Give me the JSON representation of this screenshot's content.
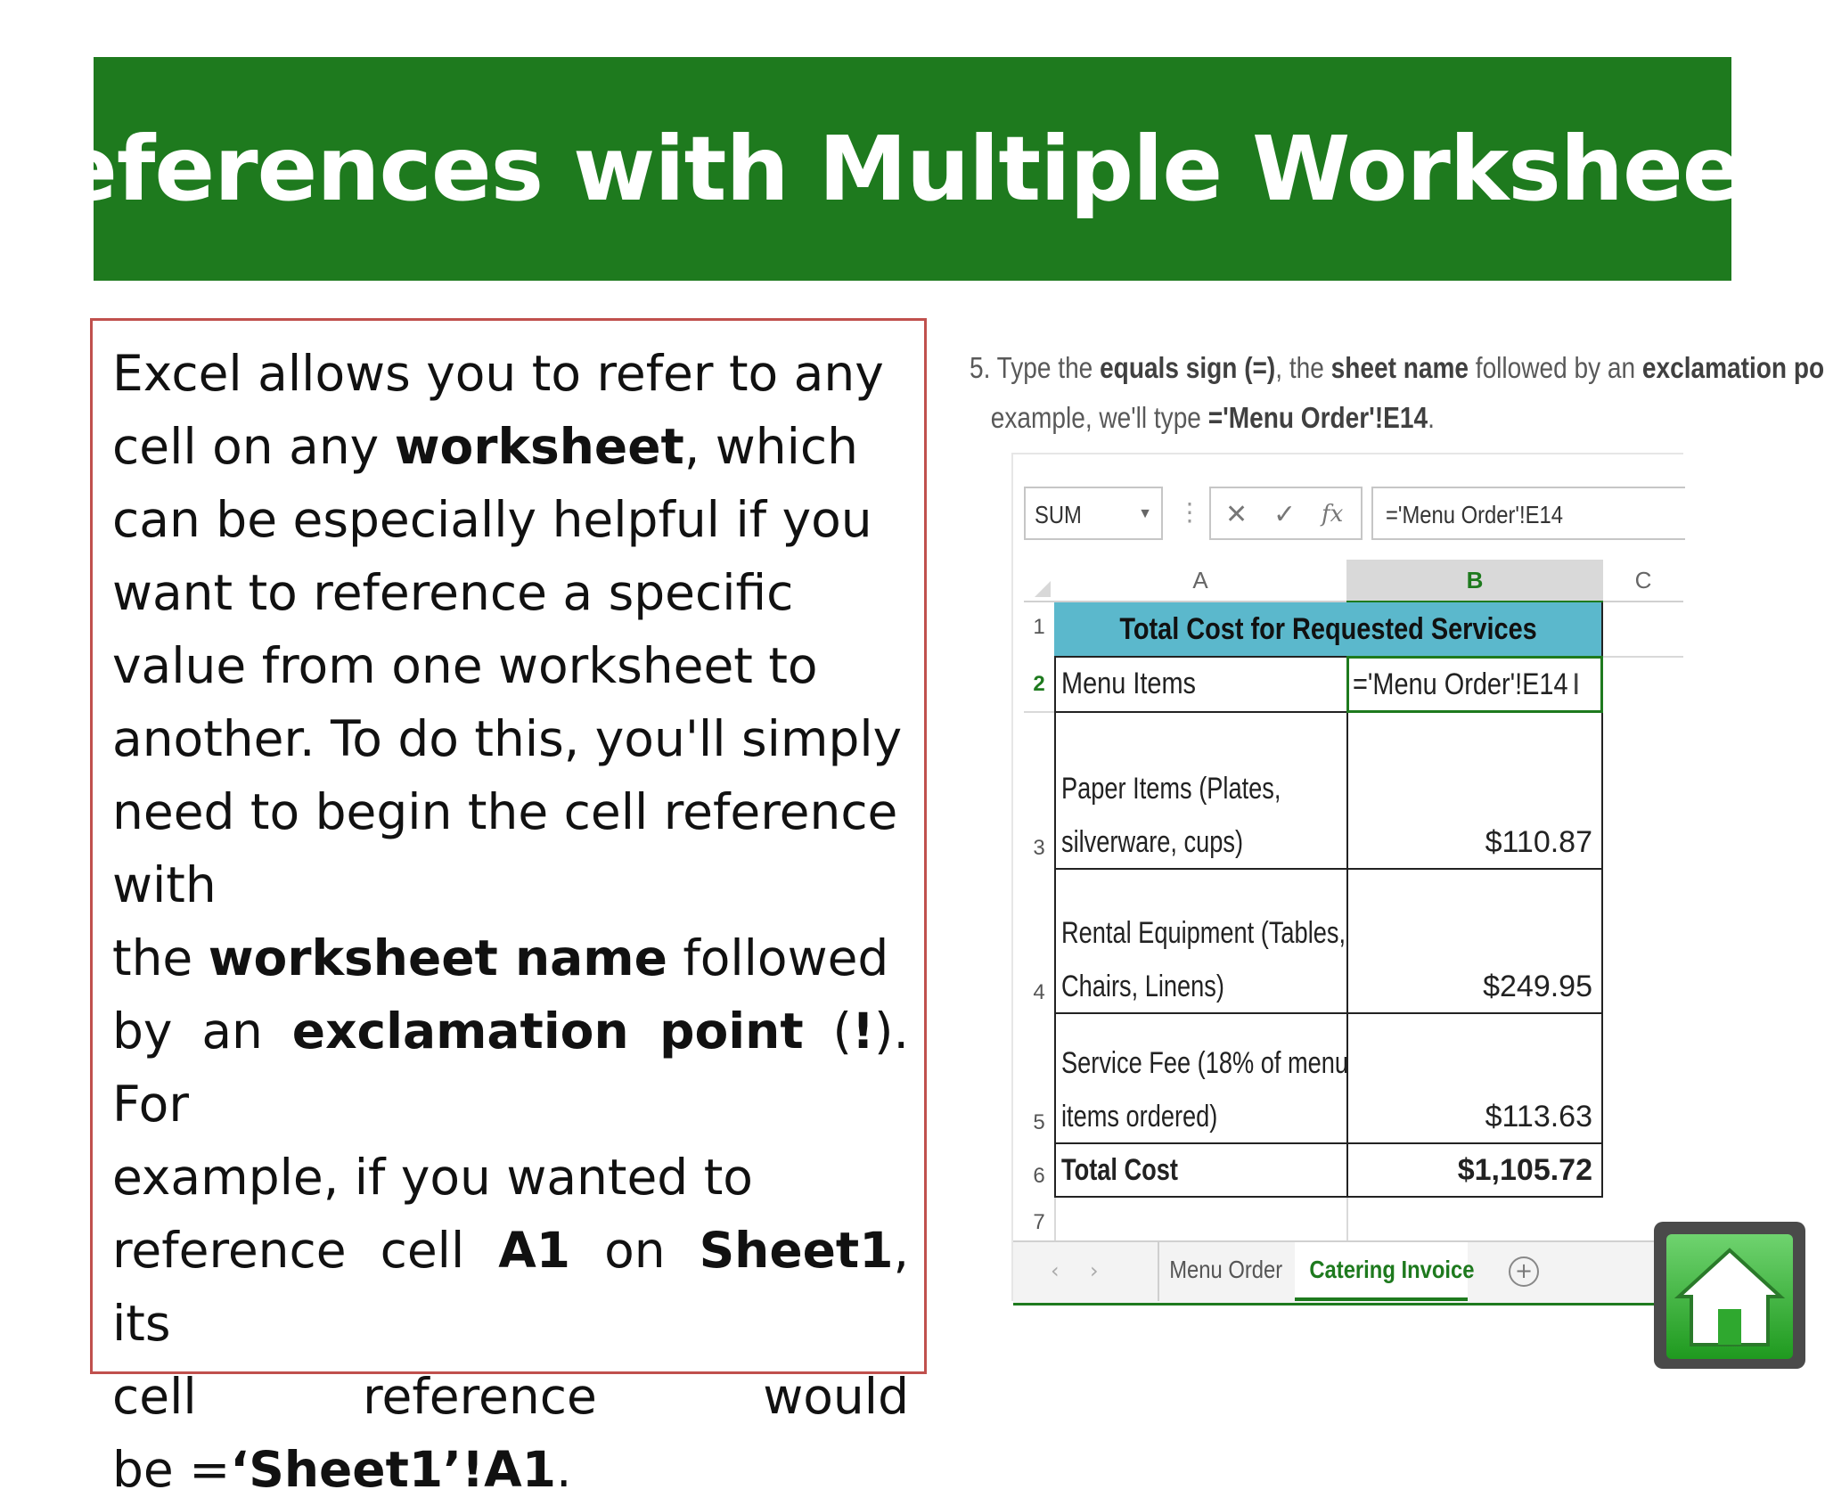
{
  "slide": {
    "title": "References with Multiple Worksheets",
    "paragraph": {
      "l1": "Excel allows you to refer to any",
      "l2a": "cell on any ",
      "l2b": "worksheet",
      "l2c": ", which",
      "l3": "can be especially helpful if you",
      "l4": "want to reference a specific",
      "l5": "value from one worksheet to",
      "l6": "another. To do this, you'll simply",
      "l7": "need to begin the cell reference",
      "l8": "with",
      "l9a": "the ",
      "l9b": "worksheet name",
      "l9c": " followed",
      "l10a": "by an ",
      "l10b": "exclamation point",
      "l10c": " (",
      "l10d": "!",
      "l10e": "). For",
      "l11": "example, if you wanted to",
      "l12a": "reference cell ",
      "l12b": "A1",
      "l12c": " on ",
      "l12d": "Sheet1",
      "l12e": ", its",
      "l13": "cell reference would",
      "l14a": "be =",
      "l14b": "‘Sheet1’!A1",
      "l14c": "."
    }
  },
  "step": {
    "p1": "5. Type the ",
    "b1": "equals sign (=)",
    "p2": ", the ",
    "b2": "sheet name",
    "p3": " followed by an ",
    "b3": "exclamation point",
    "p4": "example, we'll type ",
    "b4": "='Menu Order'!E14",
    "p5": "."
  },
  "excel": {
    "name_box": "SUM",
    "formula": "='Menu Order'!E14",
    "fx_cancel": "✕",
    "fx_enter": "✓",
    "fx_label": "fx",
    "columns": [
      "A",
      "B",
      "C"
    ],
    "rows": [
      "1",
      "2",
      "3",
      "4",
      "5",
      "6",
      "7"
    ],
    "header": "Total Cost for Requested Services",
    "cells": {
      "a2": "Menu Items",
      "b2": "='Menu Order'!E14",
      "a3_1": "Paper Items (Plates,",
      "a3_2": "silverware, cups)",
      "b3": "$110.87",
      "a4_1": "Rental Equipment (Tables,",
      "a4_2": "Chairs, Linens)",
      "b4": "$249.95",
      "a5_1": "Service Fee (18% of menu",
      "a5_2": "items ordered)",
      "b5": "$113.63",
      "a6": "Total Cost",
      "b6": "$1,105.72"
    },
    "tabs": [
      "Menu Order",
      "Catering Invoice"
    ],
    "active_tab": "Catering Invoice"
  },
  "colors": {
    "banner": "#1e7a1e",
    "box_border": "#c0504d",
    "header_fill": "#5bb8cc"
  },
  "icons": [
    "home-icon",
    "add-sheet-icon",
    "dropdown-arrow-icon"
  ]
}
